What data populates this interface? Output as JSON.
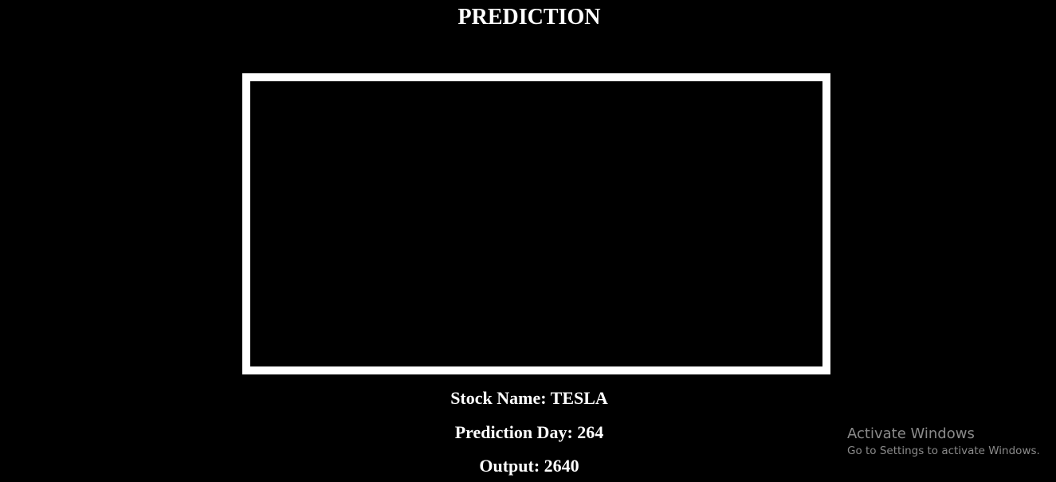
{
  "page": {
    "title": "PREDICTION"
  },
  "details": {
    "stock_name": "Stock Name: TESLA",
    "prediction_day": "Prediction Day: 264",
    "output": "Output: 2640"
  },
  "watermark": {
    "title": "Activate Windows",
    "subtitle": "Go to Settings to activate Windows."
  },
  "colors": {
    "background": "#000000",
    "text": "#ffffff",
    "frame_border": "#ffffff",
    "watermark": "#8a8a8a"
  }
}
